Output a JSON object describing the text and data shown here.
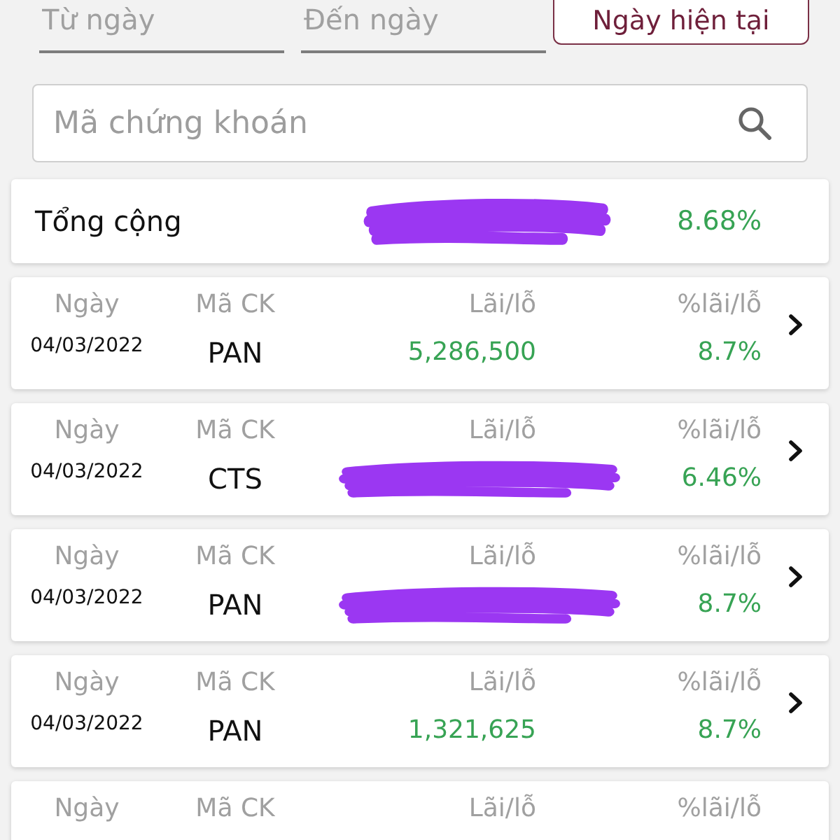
{
  "date_filter": {
    "from": {
      "placeholder": "Từ ngày"
    },
    "to": {
      "placeholder": "Đến ngày"
    },
    "today_button": "Ngày hiện tại"
  },
  "search": {
    "placeholder": "Mã chứng khoán"
  },
  "total": {
    "label": "Tổng cộng",
    "redacted": true,
    "percent": "8.68%"
  },
  "cards": [
    {
      "headers": [
        "Ngày",
        "Mã CK",
        "Lãi/lỗ",
        "%lãi/lỗ"
      ],
      "date": "04/03/2022",
      "symbol": "PAN",
      "redacted": false,
      "profit": "5,286,500",
      "percent": "8.7%"
    },
    {
      "headers": [
        "Ngày",
        "Mã CK",
        "Lãi/lỗ",
        "%lãi/lỗ"
      ],
      "date": "04/03/2022",
      "symbol": "CTS",
      "redacted": true,
      "percent": "6.46%"
    },
    {
      "headers": [
        "Ngày",
        "Mã CK",
        "Lãi/lỗ",
        "%lãi/lỗ"
      ],
      "date": "04/03/2022",
      "symbol": "PAN",
      "redacted": true,
      "percent": "8.7%"
    },
    {
      "headers": [
        "Ngày",
        "Mã CK",
        "Lãi/lỗ",
        "%lãi/lỗ"
      ],
      "date": "04/03/2022",
      "symbol": "PAN",
      "redacted": false,
      "profit": "1,321,625",
      "percent": "8.7%"
    },
    {
      "headers": [
        "Ngày",
        "Mã CK",
        "Lãi/lỗ",
        "%lãi/lỗ"
      ]
    }
  ]
}
